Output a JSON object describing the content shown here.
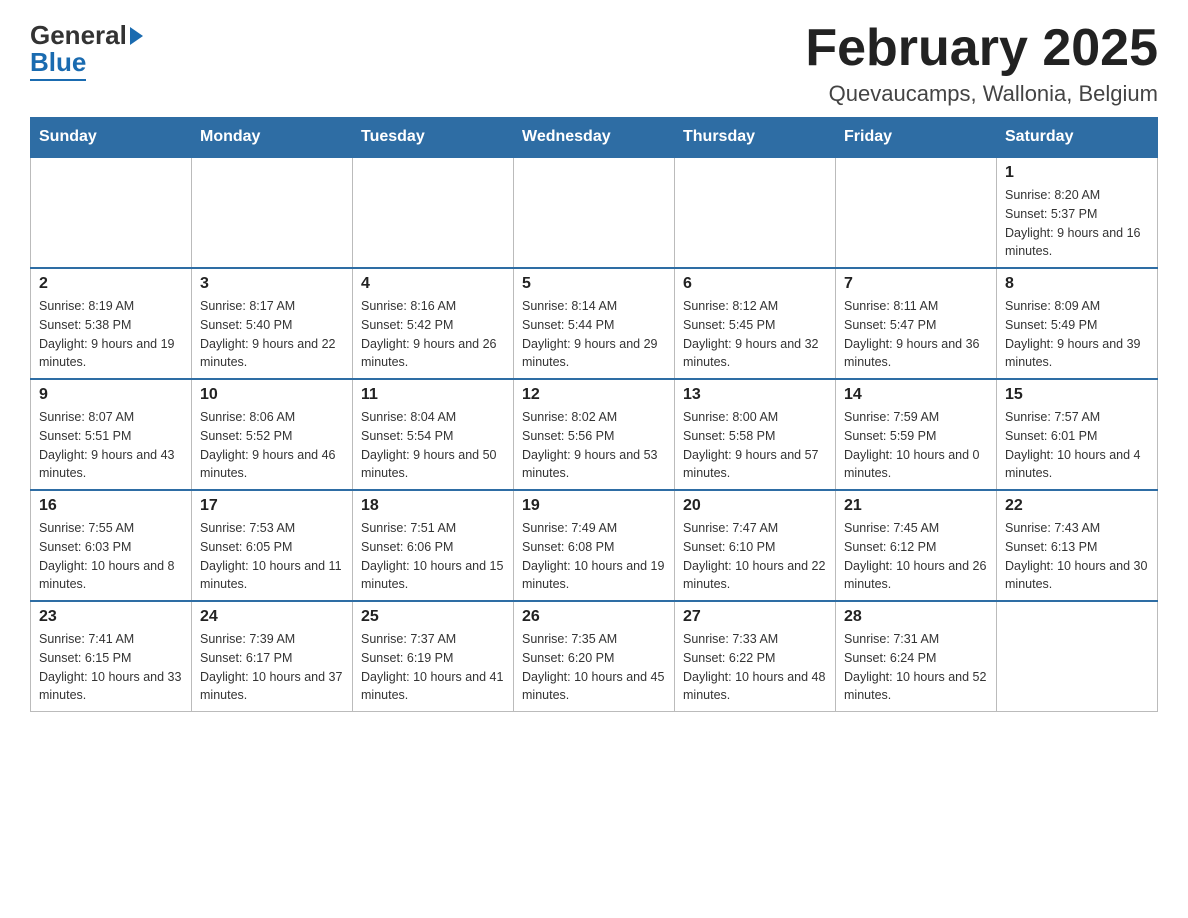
{
  "header": {
    "title": "February 2025",
    "location": "Quevaucamps, Wallonia, Belgium",
    "logo_general": "General",
    "logo_blue": "Blue"
  },
  "days_of_week": [
    "Sunday",
    "Monday",
    "Tuesday",
    "Wednesday",
    "Thursday",
    "Friday",
    "Saturday"
  ],
  "weeks": [
    [
      {
        "day": "",
        "info": ""
      },
      {
        "day": "",
        "info": ""
      },
      {
        "day": "",
        "info": ""
      },
      {
        "day": "",
        "info": ""
      },
      {
        "day": "",
        "info": ""
      },
      {
        "day": "",
        "info": ""
      },
      {
        "day": "1",
        "info": "Sunrise: 8:20 AM\nSunset: 5:37 PM\nDaylight: 9 hours and 16 minutes."
      }
    ],
    [
      {
        "day": "2",
        "info": "Sunrise: 8:19 AM\nSunset: 5:38 PM\nDaylight: 9 hours and 19 minutes."
      },
      {
        "day": "3",
        "info": "Sunrise: 8:17 AM\nSunset: 5:40 PM\nDaylight: 9 hours and 22 minutes."
      },
      {
        "day": "4",
        "info": "Sunrise: 8:16 AM\nSunset: 5:42 PM\nDaylight: 9 hours and 26 minutes."
      },
      {
        "day": "5",
        "info": "Sunrise: 8:14 AM\nSunset: 5:44 PM\nDaylight: 9 hours and 29 minutes."
      },
      {
        "day": "6",
        "info": "Sunrise: 8:12 AM\nSunset: 5:45 PM\nDaylight: 9 hours and 32 minutes."
      },
      {
        "day": "7",
        "info": "Sunrise: 8:11 AM\nSunset: 5:47 PM\nDaylight: 9 hours and 36 minutes."
      },
      {
        "day": "8",
        "info": "Sunrise: 8:09 AM\nSunset: 5:49 PM\nDaylight: 9 hours and 39 minutes."
      }
    ],
    [
      {
        "day": "9",
        "info": "Sunrise: 8:07 AM\nSunset: 5:51 PM\nDaylight: 9 hours and 43 minutes."
      },
      {
        "day": "10",
        "info": "Sunrise: 8:06 AM\nSunset: 5:52 PM\nDaylight: 9 hours and 46 minutes."
      },
      {
        "day": "11",
        "info": "Sunrise: 8:04 AM\nSunset: 5:54 PM\nDaylight: 9 hours and 50 minutes."
      },
      {
        "day": "12",
        "info": "Sunrise: 8:02 AM\nSunset: 5:56 PM\nDaylight: 9 hours and 53 minutes."
      },
      {
        "day": "13",
        "info": "Sunrise: 8:00 AM\nSunset: 5:58 PM\nDaylight: 9 hours and 57 minutes."
      },
      {
        "day": "14",
        "info": "Sunrise: 7:59 AM\nSunset: 5:59 PM\nDaylight: 10 hours and 0 minutes."
      },
      {
        "day": "15",
        "info": "Sunrise: 7:57 AM\nSunset: 6:01 PM\nDaylight: 10 hours and 4 minutes."
      }
    ],
    [
      {
        "day": "16",
        "info": "Sunrise: 7:55 AM\nSunset: 6:03 PM\nDaylight: 10 hours and 8 minutes."
      },
      {
        "day": "17",
        "info": "Sunrise: 7:53 AM\nSunset: 6:05 PM\nDaylight: 10 hours and 11 minutes."
      },
      {
        "day": "18",
        "info": "Sunrise: 7:51 AM\nSunset: 6:06 PM\nDaylight: 10 hours and 15 minutes."
      },
      {
        "day": "19",
        "info": "Sunrise: 7:49 AM\nSunset: 6:08 PM\nDaylight: 10 hours and 19 minutes."
      },
      {
        "day": "20",
        "info": "Sunrise: 7:47 AM\nSunset: 6:10 PM\nDaylight: 10 hours and 22 minutes."
      },
      {
        "day": "21",
        "info": "Sunrise: 7:45 AM\nSunset: 6:12 PM\nDaylight: 10 hours and 26 minutes."
      },
      {
        "day": "22",
        "info": "Sunrise: 7:43 AM\nSunset: 6:13 PM\nDaylight: 10 hours and 30 minutes."
      }
    ],
    [
      {
        "day": "23",
        "info": "Sunrise: 7:41 AM\nSunset: 6:15 PM\nDaylight: 10 hours and 33 minutes."
      },
      {
        "day": "24",
        "info": "Sunrise: 7:39 AM\nSunset: 6:17 PM\nDaylight: 10 hours and 37 minutes."
      },
      {
        "day": "25",
        "info": "Sunrise: 7:37 AM\nSunset: 6:19 PM\nDaylight: 10 hours and 41 minutes."
      },
      {
        "day": "26",
        "info": "Sunrise: 7:35 AM\nSunset: 6:20 PM\nDaylight: 10 hours and 45 minutes."
      },
      {
        "day": "27",
        "info": "Sunrise: 7:33 AM\nSunset: 6:22 PM\nDaylight: 10 hours and 48 minutes."
      },
      {
        "day": "28",
        "info": "Sunrise: 7:31 AM\nSunset: 6:24 PM\nDaylight: 10 hours and 52 minutes."
      },
      {
        "day": "",
        "info": ""
      }
    ]
  ]
}
